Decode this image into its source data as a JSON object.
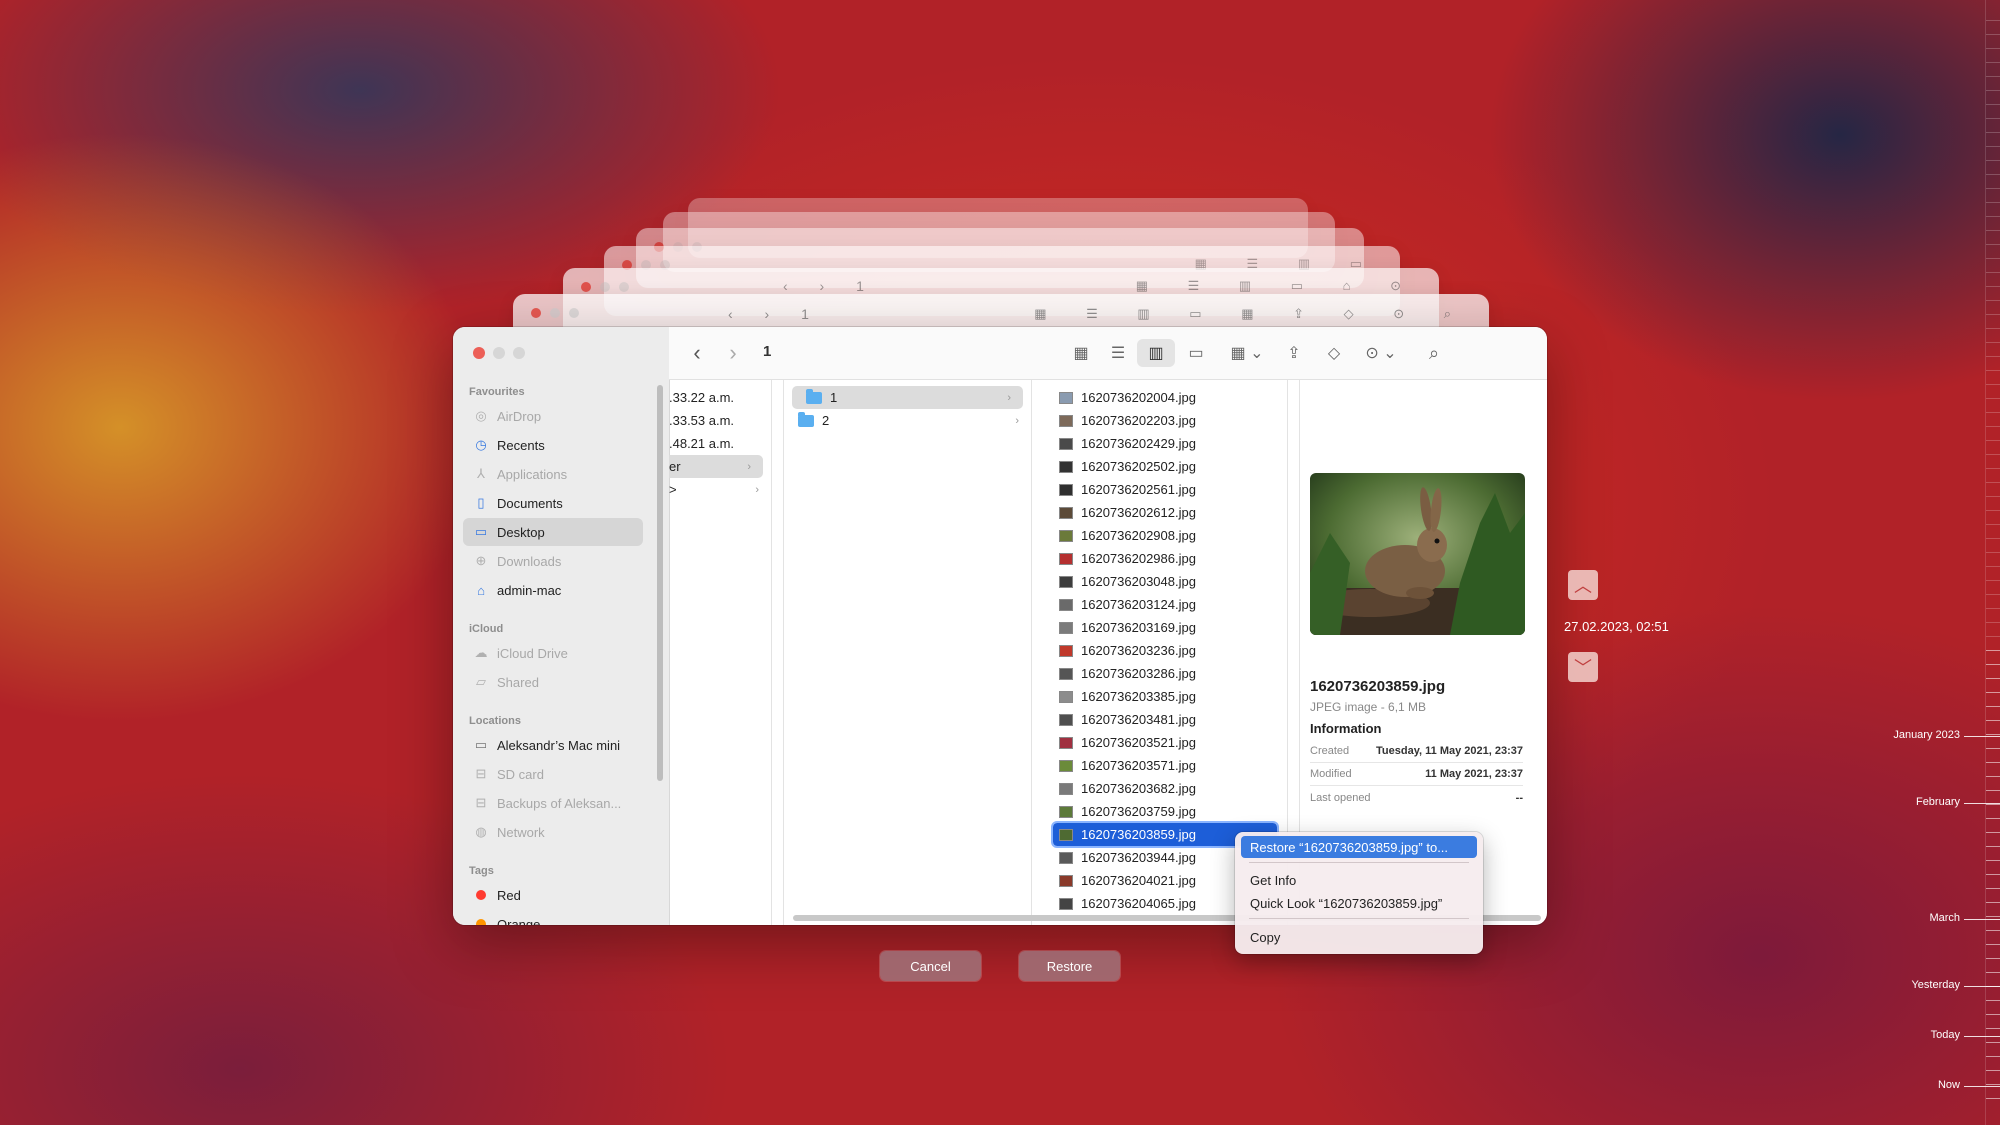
{
  "toolbar": {
    "folder_title": "1",
    "back_icon": "chevron-left-icon",
    "forward_icon": "chevron-right-icon"
  },
  "sidebar": {
    "favourites_header": "Favourites",
    "favourites": [
      {
        "label": "AirDrop",
        "icon": "airdrop-icon",
        "dim": true
      },
      {
        "label": "Recents",
        "icon": "clock-icon",
        "dim": false
      },
      {
        "label": "Applications",
        "icon": "applications-icon",
        "dim": true
      },
      {
        "label": "Documents",
        "icon": "document-icon",
        "dim": false
      },
      {
        "label": "Desktop",
        "icon": "desktop-icon",
        "dim": false,
        "selected": true
      },
      {
        "label": "Downloads",
        "icon": "download-icon",
        "dim": true
      },
      {
        "label": "admin-mac",
        "icon": "home-icon",
        "dim": false
      }
    ],
    "icloud_header": "iCloud",
    "icloud": [
      {
        "label": "iCloud Drive",
        "icon": "cloud-icon",
        "dim": true
      },
      {
        "label": "Shared",
        "icon": "shared-folder-icon",
        "dim": true
      }
    ],
    "locations_header": "Locations",
    "locations": [
      {
        "label": "Aleksandr’s Mac mini",
        "icon": "computer-icon",
        "dim": false
      },
      {
        "label": "SD card",
        "icon": "drive-icon",
        "dim": true
      },
      {
        "label": "Backups of Aleksan...",
        "icon": "drive-icon",
        "dim": true
      },
      {
        "label": "Network",
        "icon": "globe-icon",
        "dim": true
      }
    ],
    "tags_header": "Tags",
    "tags": [
      {
        "label": "Red",
        "color": "#ff3b30"
      },
      {
        "label": "Orange",
        "color": "#ff9500"
      }
    ]
  },
  "column1": {
    "rows": [
      ".33.22 a.m.",
      ".33.53 a.m.",
      ".48.21 a.m.",
      "er",
      ">"
    ]
  },
  "column2": {
    "rows": [
      {
        "label": "1",
        "selected": true
      },
      {
        "label": "2",
        "selected": false
      }
    ]
  },
  "files": [
    "1620736202004.jpg",
    "1620736202203.jpg",
    "1620736202429.jpg",
    "1620736202502.jpg",
    "1620736202561.jpg",
    "1620736202612.jpg",
    "1620736202908.jpg",
    "1620736202986.jpg",
    "1620736203048.jpg",
    "1620736203124.jpg",
    "1620736203169.jpg",
    "1620736203236.jpg",
    "1620736203286.jpg",
    "1620736203385.jpg",
    "1620736203481.jpg",
    "1620736203521.jpg",
    "1620736203571.jpg",
    "1620736203682.jpg",
    "1620736203759.jpg",
    "1620736203859.jpg",
    "1620736203944.jpg",
    "1620736204021.jpg",
    "1620736204065.jpg"
  ],
  "selected_file_index": 19,
  "preview": {
    "filename": "1620736203859.jpg",
    "kind": "JPEG image - 6,1 MB",
    "info_header": "Information",
    "created_label": "Created",
    "created_value": "Tuesday, 11 May 2021, 23:37",
    "modified_label": "Modified",
    "modified_value": "11 May 2021, 23:37",
    "last_opened_label": "Last opened",
    "last_opened_value": "--"
  },
  "context_menu": {
    "restore": "Restore “1620736203859.jpg” to...",
    "get_info": "Get Info",
    "quick_look": "Quick Look “1620736203859.jpg”",
    "copy": "Copy"
  },
  "buttons": {
    "cancel": "Cancel",
    "restore": "Restore"
  },
  "timemachine": {
    "current_date": "27.02.2023, 02:51",
    "timeline": [
      "January 2023",
      "February",
      "March",
      "Yesterday",
      "Today",
      "Now"
    ]
  },
  "colors": {
    "selection_blue": "#1d5ed8",
    "menu_highlight": "#3b7ce0",
    "close_red": "#ec5f57"
  }
}
